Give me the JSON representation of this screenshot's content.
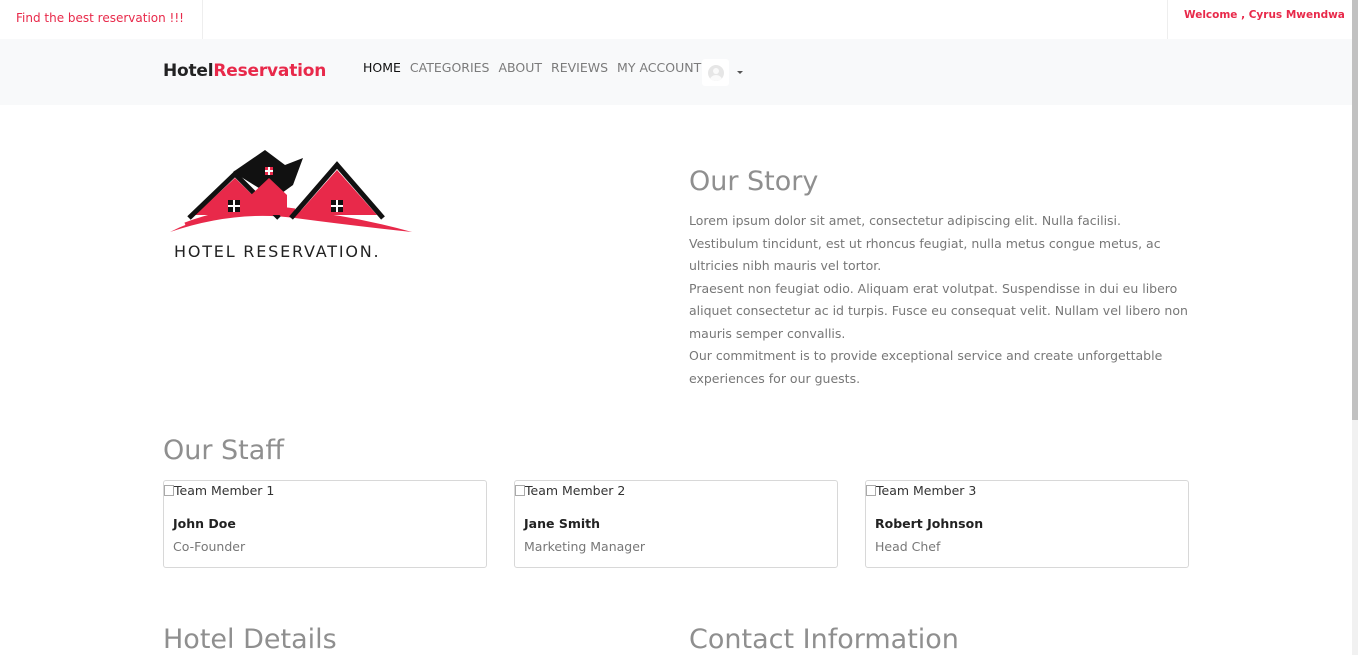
{
  "topbar": {
    "promo": "Find the best reservation !!!",
    "welcome": "Welcome , Cyrus Mwendwa"
  },
  "brand": {
    "part1": "Hotel",
    "part2": "Reservation"
  },
  "nav": {
    "home": "HOME",
    "categories": "CATEGORIES",
    "about": "ABOUT",
    "reviews": "REVIEWS",
    "account": "MY ACCOUNT"
  },
  "logo": {
    "text": "HOTEL RESERVATION."
  },
  "story": {
    "title": "Our Story",
    "p1": "Lorem ipsum dolor sit amet, consectetur adipiscing elit. Nulla facilisi. Vestibulum tincidunt, est ut rhoncus feugiat, nulla metus congue metus, ac ultricies nibh mauris vel tortor.",
    "p2": "Praesent non feugiat odio. Aliquam erat volutpat. Suspendisse in dui eu libero aliquet consectetur ac id turpis. Fusce eu consequat velit. Nullam vel libero non mauris semper convallis.",
    "p3": "Our commitment is to provide exceptional service and create unforgettable experiences for our guests."
  },
  "staff": {
    "title": "Our Staff",
    "members": [
      {
        "img_alt": "Team Member 1",
        "name": "John Doe",
        "role": "Co-Founder"
      },
      {
        "img_alt": "Team Member 2",
        "name": "Jane Smith",
        "role": "Marketing Manager"
      },
      {
        "img_alt": "Team Member 3",
        "name": "Robert Johnson",
        "role": "Head Chef"
      }
    ]
  },
  "hotel_details": {
    "title": "Hotel Details"
  },
  "contact": {
    "title": "Contact Information"
  },
  "colors": {
    "accent": "#e8294a",
    "muted": "#8f8f8f",
    "navbar_bg": "#f8f9fa"
  }
}
